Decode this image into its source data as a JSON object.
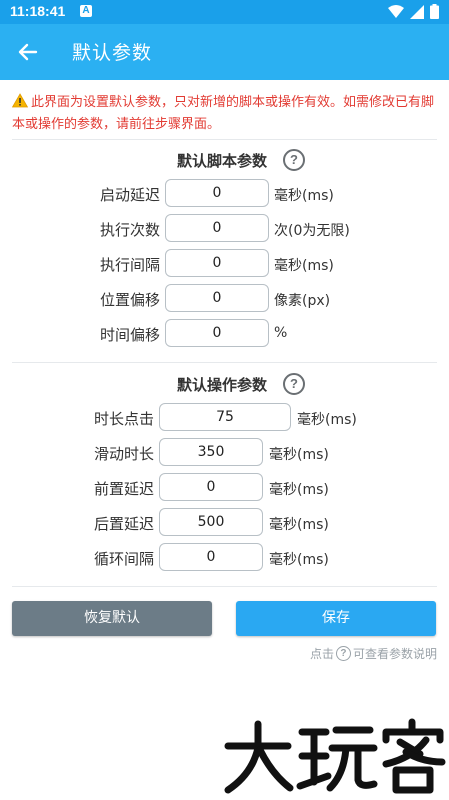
{
  "status_bar": {
    "time": "11:18:41",
    "notification_letter": "A"
  },
  "app_bar": {
    "title": "默认参数"
  },
  "notice": {
    "text": "此界面为设置默认参数，只对新增的脚本或操作有效。如需修改已有脚本或操作的参数，请前往步骤界面。"
  },
  "script_section": {
    "title": "默认脚本参数",
    "rows": [
      {
        "label": "启动延迟",
        "value": "0",
        "unit": "毫秒(ms)"
      },
      {
        "label": "执行次数",
        "value": "0",
        "unit": "次(0为无限)"
      },
      {
        "label": "执行间隔",
        "value": "0",
        "unit": "毫秒(ms)"
      },
      {
        "label": "位置偏移",
        "value": "0",
        "unit": "像素(px)"
      },
      {
        "label": "时间偏移",
        "value": "0",
        "unit": "%"
      }
    ]
  },
  "operation_section": {
    "title": "默认操作参数",
    "rows": [
      {
        "label": "时长点击",
        "value": "75",
        "unit": "毫秒(ms)"
      },
      {
        "label": "滑动时长",
        "value": "350",
        "unit": "毫秒(ms)"
      },
      {
        "label": "前置延迟",
        "value": "0",
        "unit": "毫秒(ms)"
      },
      {
        "label": "后置延迟",
        "value": "500",
        "unit": "毫秒(ms)"
      },
      {
        "label": "循环间隔",
        "value": "0",
        "unit": "毫秒(ms)"
      }
    ]
  },
  "buttons": {
    "reset": "恢复默认",
    "save": "保存"
  },
  "hint": {
    "prefix": "点击",
    "suffix": "可查看参数说明"
  },
  "watermark": {
    "text": "大玩客"
  },
  "colors": {
    "app_bar": "#2bb0f2",
    "status_bar": "#1aa0ea",
    "notice_text": "#e23b33",
    "reset_button": "#6c7c87",
    "save_button": "#2aa8f2"
  }
}
